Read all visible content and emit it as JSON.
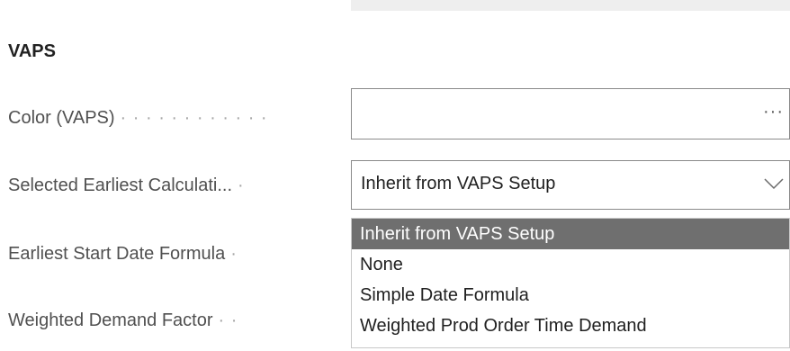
{
  "section": {
    "title": "VAPS"
  },
  "fields": {
    "color": {
      "label": "Color (VAPS)",
      "dots": "· · · · · · · · · · · ·",
      "value": "",
      "assist_glyph": "···"
    },
    "earliest_calc": {
      "label": "Selected Earliest Calculati...",
      "dots": "·",
      "value": "Inherit from VAPS Setup"
    },
    "earliest_start": {
      "label": "Earliest Start Date Formula",
      "dots": "·"
    },
    "weighted_demand": {
      "label": "Weighted Demand Factor",
      "dots": "· ·"
    }
  },
  "dropdown": {
    "options": [
      "Inherit from VAPS Setup",
      "None",
      "Simple Date Formula",
      "Weighted Prod Order Time Demand"
    ],
    "selected": "Inherit from VAPS Setup"
  },
  "colors": {
    "selected_bg": "#6f6f6f",
    "border": "#8a8a8a",
    "label_text": "#505050"
  }
}
